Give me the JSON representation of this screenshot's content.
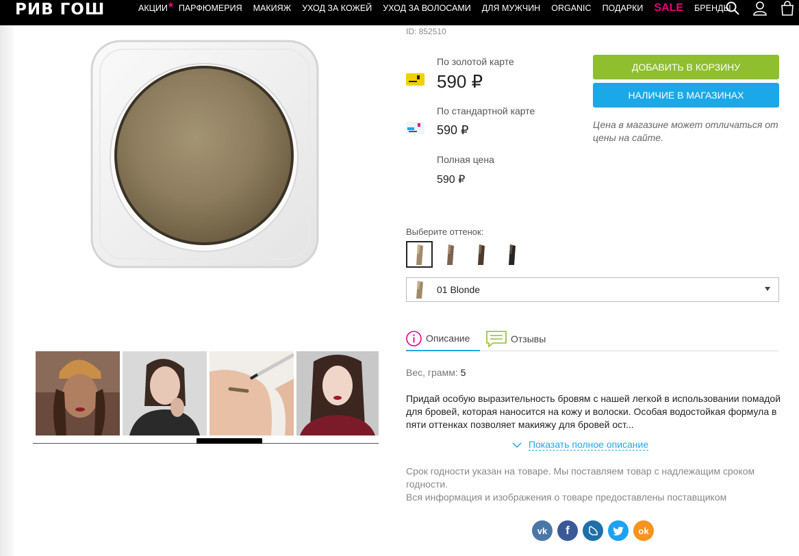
{
  "header": {
    "logo": "РИВ ГОШ",
    "nav": [
      "АКЦИИ",
      "ПАРФЮМЕРИЯ",
      "МАКИЯЖ",
      "УХОД ЗА КОЖЕЙ",
      "УХОД ЗА ВОЛОСАМИ",
      "ДЛЯ МУЖЧИН",
      "ORGANIC",
      "ПОДАРКИ",
      "SALE",
      "БРЕНДЫ"
    ],
    "star": "★",
    "icons": [
      "search-icon",
      "user-icon",
      "cart-icon"
    ]
  },
  "product": {
    "id": "ID: 852510",
    "gold_label": "По золотой карте",
    "gold_price": "590 ₽",
    "standard_label": "По стандартной карте",
    "standard_price": "590 ₽",
    "full_label": "Полная цена",
    "full_price": "590 ₽",
    "add_to_cart": "ДОБАВИТЬ В КОРЗИНУ",
    "availability": "НАЛИЧИЕ В МАГАЗИНАХ",
    "price_note": "Цена в магазине может отличаться от цены на сайте."
  },
  "shade": {
    "label": "Выберите оттенок:",
    "selected": "01 Blonde",
    "swatch_colors": [
      "#a08a6a",
      "#7c6450",
      "#4e3a2c",
      "#2b2420"
    ]
  },
  "tabs": {
    "description": "Описание",
    "reviews": "Отзывы"
  },
  "details": {
    "weight_label": "Вес, грамм:",
    "weight_value": "5",
    "description": "Придай особую выразительность бровям с нашей легкой в использовании помадой для бровей, которая наносится на кожу и волоски. Особая водостойкая формула в пяти оттенках позволяет макияжу для бровей ост...",
    "show_more": "Показать полное описание",
    "info_1": "Срок годности указан на товаре. Мы поставляем товар с надлежащим сроком годности.",
    "info_2": "Вся информация и изображения о товаре предоставлены поставщиком"
  },
  "social": {
    "vk": "vk",
    "fb": "f",
    "ok": "ok",
    "icons": [
      "vk-icon",
      "facebook-icon",
      "livejournal-icon",
      "twitter-icon",
      "odnoklassniki-icon"
    ]
  },
  "colors": {
    "accent_green": "#8fbe2f",
    "accent_blue": "#1ba8e8",
    "sale_pink": "#e5007e"
  }
}
